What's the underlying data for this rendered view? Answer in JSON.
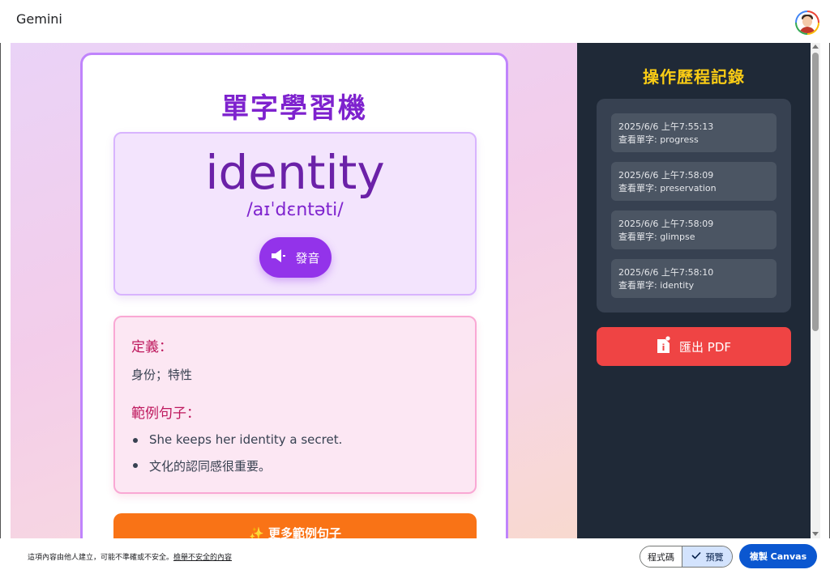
{
  "app": {
    "title": "Gemini"
  },
  "card": {
    "title": "單字學習機",
    "word": "identity",
    "phonetic": "/aɪˈdɛntəti/",
    "speak_label": "發音",
    "definition_label": "定義：",
    "definition": "身份；特性",
    "examples_label": "範例句子：",
    "examples": [
      "She keeps her identity a secret.",
      "文化的認同感很重要。"
    ],
    "more_label": "✨ 更多範例句子"
  },
  "history": {
    "title": "操作歷程記錄",
    "entries": [
      {
        "time": "2025/6/6 上午7:55:13",
        "action": "查看單字: progress"
      },
      {
        "time": "2025/6/6 上午7:58:09",
        "action": "查看單字: preservation"
      },
      {
        "time": "2025/6/6 上午7:58:09",
        "action": "查看單字: glimpse"
      },
      {
        "time": "2025/6/6 上午7:58:10",
        "action": "查看單字: identity"
      }
    ],
    "export_label": "匯出 PDF"
  },
  "footer": {
    "disclaimer": "這項內容由他人建立，可能不準確或不安全。",
    "report_link": "檢舉不安全的內容",
    "code_label": "程式碼",
    "preview_label": "預覽",
    "copy_label": "複製 Canvas"
  },
  "colors": {
    "accent_purple": "#9333ea",
    "title_purple": "#7e22ce",
    "pink_label": "#be185d",
    "orange_button": "#f97316",
    "panel_bg": "#1f2937",
    "panel_title": "#facc15",
    "export_red": "#ef4444",
    "copy_blue": "#0b57d0"
  },
  "icons": [
    "speaker-icon",
    "sparkles-icon",
    "file-icon",
    "checkmark-icon",
    "avatar"
  ]
}
